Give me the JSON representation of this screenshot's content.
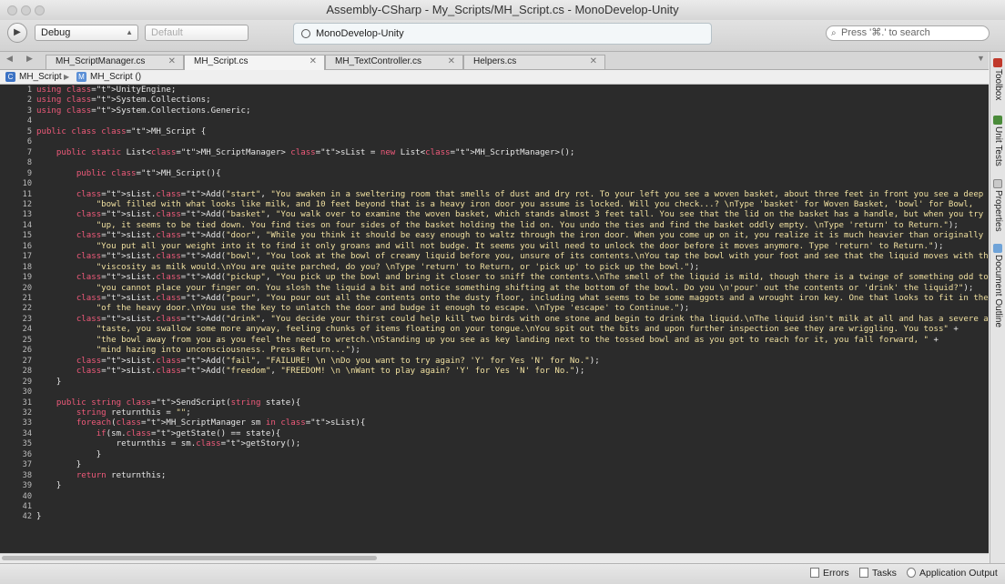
{
  "window": {
    "title": "Assembly-CSharp - My_Scripts/MH_Script.cs - MonoDevelop-Unity"
  },
  "toolbar": {
    "config": "Debug",
    "target_placeholder": "Default",
    "status_text": "MonoDevelop-Unity",
    "search_placeholder": "Press '⌘.' to search"
  },
  "tabs": [
    {
      "label": "MH_ScriptManager.cs",
      "active": false
    },
    {
      "label": "MH_Script.cs",
      "active": true
    },
    {
      "label": "MH_TextController.cs",
      "active": false
    },
    {
      "label": "Helpers.cs",
      "active": false
    }
  ],
  "breadcrumb": {
    "class": "MH_Script",
    "member": "MH_Script ()"
  },
  "editor": {
    "line_numbers": [
      "1",
      "2",
      "3",
      "4",
      "5",
      "6",
      "7",
      "8",
      "9",
      "10",
      "11",
      "12",
      "13",
      "14",
      "15",
      "16",
      "17",
      "18",
      "19",
      "20",
      "21",
      "22",
      "23",
      "24",
      "25",
      "26",
      "27",
      "28",
      "29",
      "30",
      "31",
      "32",
      "33",
      "34",
      "35",
      "36",
      "37",
      "38",
      "39",
      "40",
      "41",
      "42"
    ],
    "lines": [
      "using UnityEngine;",
      "using System.Collections;",
      "using System.Collections.Generic;",
      "",
      "public class MH_Script {",
      "",
      "    public static List<MH_ScriptManager> sList = new List<MH_ScriptManager>();",
      "",
      "        public MH_Script(){",
      "",
      "        sList.Add(\"start\", \"You awaken in a sweltering room that smells of dust and dry rot. To your left you see a woven basket, about three feet in front you see a deep steel \" +",
      "            \"bowl filled with what looks like milk, and 10 feet beyond that is a heavy iron door you assume is locked. Will you check...? \\nType 'basket' for Woven Basket, 'bowl' for Bowl,",
      "        sList.Add(\"basket\", \"You walk over to examine the woven basket, which stands almost 3 feet tall. You see that the lid on the basket has a handle, but when you try to pull \" +",
      "            \"up, it seems to be tied down. You find ties on four sides of the basket holding the lid on. You undo the ties and find the basket oddly empty. \\nType 'return' to Return.\");",
      "        sList.Add(\"door\", \"While you think it should be easy enough to waltz through the iron door. When you come up on it, you realize it is much heavier than originally thought. \" +",
      "            \"You put all your weight into it to find it only groans and will not budge. It seems you will need to unlock the door before it moves anymore. Type 'return' to Return.\");",
      "        sList.Add(\"bowl\", \"You look at the bowl of creamy liquid before you, unsure of its contents.\\nYou tap the bowl with your foot and see that the liquid moves with the same \" +",
      "            \"viscosity as milk would.\\nYou are quite parched, do you? \\nType 'return' to Return, or 'pick up' to pick up the bowl.\");",
      "        sList.Add(\"pickup\", \"You pick up the bowl and bring it closer to sniff the contents.\\nThe smell of the liquid is mild, though there is a twinge of something odd to it that \" +",
      "            \"you cannot place your finger on. You slosh the liquid a bit and notice something shifting at the bottom of the bowl. Do you \\n'pour' out the contents or 'drink' the liquid?\");",
      "        sList.Add(\"pour\", \"You pour out all the contents onto the dusty floor, including what seems to be some maggots and a wrought iron key. One that looks to fit in the keyhole \" +",
      "            \"of the heavy door.\\nYou use the key to unlatch the door and budge it enough to escape. \\nType 'escape' to Continue.\");",
      "        sList.Add(\"drink\", \"You decide your thirst could help kill two birds with one stone and begin to drink tha liquid.\\nThe liquid isn't milk at all and has a severe acrid \" +",
      "            \"taste, you swallow some more anyway, feeling chunks of items floating on your tongue.\\nYou spit out the bits and upon further inspection see they are wriggling. You toss\" +",
      "            \"the bowl away from you as you feel the need to wretch.\\nStanding up you see as key landing next to the tossed bowl and as you got to reach for it, you fall forward, \" +",
      "            \"mind hazing into unconsciousness. Press Return...\");",
      "        sList.Add(\"fail\", \"FAILURE! \\n \\nDo you want to try again? 'Y' for Yes 'N' for No.\");",
      "        sList.Add(\"freedom\", \"FREEDOM! \\n \\nWant to play again? 'Y' for Yes 'N' for No.\");",
      "    }",
      "",
      "    public string SendScript(string state){",
      "        string returnthis = \"\";",
      "        foreach(MH_ScriptManager sm in sList){",
      "            if(sm.getState() == state){",
      "                returnthis = sm.getStory();",
      "            }",
      "        }",
      "        return returnthis;",
      "    }",
      "",
      "",
      "}"
    ]
  },
  "side_panels": [
    "Toolbox",
    "Unit Tests",
    "Properties",
    "Document Outline"
  ],
  "statusbar": {
    "errors": "Errors",
    "tasks": "Tasks",
    "output": "Application Output"
  },
  "colors": {
    "editor_bg": "#2b2b2b",
    "keyword": "#ef5a7a",
    "identifier": "#f4dc70",
    "text": "#e6e6e6"
  }
}
